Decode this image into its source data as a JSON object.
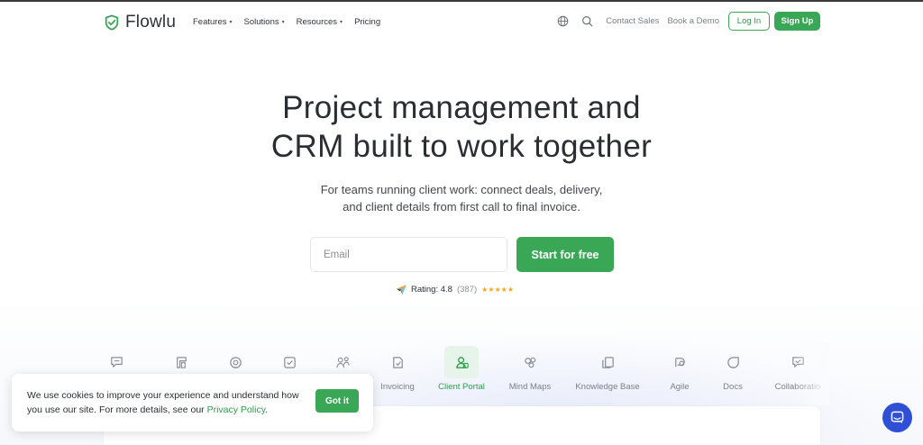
{
  "brand": {
    "name": "Flowlu",
    "accent": "#3aa756"
  },
  "nav": {
    "items": [
      {
        "label": "Features",
        "has_dropdown": true
      },
      {
        "label": "Solutions",
        "has_dropdown": true
      },
      {
        "label": "Resources",
        "has_dropdown": true
      },
      {
        "label": "Pricing",
        "has_dropdown": false
      }
    ],
    "caret": "▾"
  },
  "header_actions": {
    "globe_icon": "globe-icon",
    "search_icon": "search-icon",
    "contact_sales": "Contact Sales",
    "book_demo": "Book a Demo",
    "login": "Log In",
    "signup": "Sign Up"
  },
  "hero": {
    "title_line1": "Project management and",
    "title_line2": "CRM built to work together",
    "subtitle_line1": "For teams running client work: connect deals, delivery,",
    "subtitle_line2": "and client details from first call to final invoice.",
    "email_placeholder": "Email",
    "cta": "Start for free"
  },
  "rating": {
    "label": "Rating: 4.8",
    "count": "(387)",
    "stars": "★★★★★",
    "stars_value": 4.8
  },
  "feature_tabs": [
    {
      "label": "",
      "icon": "chat-bubble-icon"
    },
    {
      "label": "",
      "icon": "scroll-icon"
    },
    {
      "label": "",
      "icon": "coin-icon"
    },
    {
      "label": "",
      "icon": "checklist-icon"
    },
    {
      "label": "",
      "icon": "people-icon"
    },
    {
      "label": "Invoicing",
      "icon": "invoice-icon"
    },
    {
      "label": "Client Portal",
      "icon": "client-portal-icon",
      "active": true
    },
    {
      "label": "Mind Maps",
      "icon": "mind-map-icon"
    },
    {
      "label": "Knowledge Base",
      "icon": "knowledge-base-icon"
    },
    {
      "label": "Agile",
      "icon": "agile-icon"
    },
    {
      "label": "Docs",
      "icon": "docs-icon"
    },
    {
      "label": "Collaboratio",
      "icon": "collaboration-icon"
    }
  ],
  "cookie": {
    "text_before": "We use cookies to improve your experience and understand how you use our site. For more details, see our ",
    "link": "Privacy Policy",
    "text_after": ".",
    "button": "Got it"
  },
  "chat": {
    "icon": "chat-icon"
  }
}
